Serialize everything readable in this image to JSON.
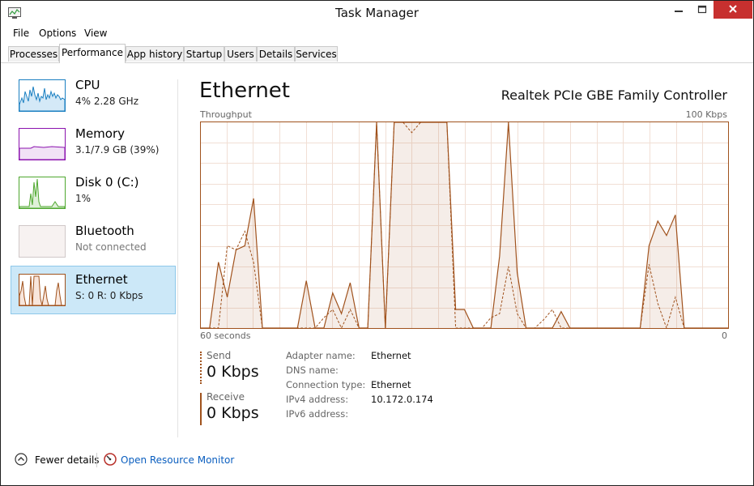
{
  "window": {
    "title": "Task Manager"
  },
  "menu": [
    "File",
    "Options",
    "View"
  ],
  "tabs": [
    "Processes",
    "Performance",
    "App history",
    "Startup",
    "Users",
    "Details",
    "Services"
  ],
  "active_tab": "Performance",
  "sidebar": {
    "items": [
      {
        "name": "CPU",
        "sub": "4% 2.28 GHz",
        "color": "#1a7fc1"
      },
      {
        "name": "Memory",
        "sub": "3.1/7.9 GB (39%)",
        "color": "#8b12ae"
      },
      {
        "name": "Disk 0 (C:)",
        "sub": "1%",
        "color": "#4ea72e"
      },
      {
        "name": "Bluetooth",
        "sub": "Not connected",
        "color": "#c0c0c0"
      },
      {
        "name": "Ethernet",
        "sub": "S: 0 R: 0 Kbps",
        "color": "#a0521d",
        "selected": true
      }
    ]
  },
  "main": {
    "title": "Ethernet",
    "adapter": "Realtek PCIe GBE Family Controller",
    "graph_label": "Throughput",
    "graph_max": "100 Kbps",
    "axis_left": "60 seconds",
    "axis_right": "0"
  },
  "send": {
    "label": "Send",
    "value": "0 Kbps"
  },
  "receive": {
    "label": "Receive",
    "value": "0 Kbps"
  },
  "properties": [
    {
      "key": "Adapter name:",
      "value": "Ethernet"
    },
    {
      "key": "DNS name:",
      "value": ""
    },
    {
      "key": "Connection type:",
      "value": "Ethernet"
    },
    {
      "key": "IPv4 address:",
      "value": "10.172.0.174"
    },
    {
      "key": "IPv6 address:",
      "value": ""
    }
  ],
  "footer": {
    "fewer_details": "Fewer details",
    "resource_monitor": "Open Resource Monitor"
  },
  "chart_data": {
    "type": "area",
    "ylim": [
      0,
      100
    ],
    "x": [
      0,
      1,
      2,
      3,
      4,
      5,
      6,
      7,
      8,
      9,
      10,
      11,
      12,
      13,
      14,
      15,
      16,
      17,
      18,
      19,
      20,
      21,
      22,
      23,
      24,
      25,
      26,
      27,
      28,
      29,
      30,
      31,
      32,
      33,
      34,
      35,
      36,
      37,
      38,
      39,
      40,
      41,
      42,
      43,
      44,
      45,
      46,
      47,
      48,
      49,
      50,
      51,
      52,
      53,
      54,
      55,
      56,
      57,
      58,
      59,
      60
    ],
    "series": [
      {
        "name": "Receive",
        "values": [
          0,
          0,
          32,
          15,
          38,
          40,
          63,
          0,
          0,
          0,
          0,
          0,
          23,
          0,
          0,
          17,
          7,
          22,
          0,
          0,
          100,
          0,
          100,
          100,
          100,
          100,
          100,
          100,
          100,
          9,
          9,
          0,
          0,
          0,
          35,
          100,
          27,
          0,
          0,
          0,
          0,
          8,
          0,
          0,
          0,
          0,
          0,
          0,
          0,
          0,
          0,
          40,
          52,
          45,
          55,
          0,
          0,
          0,
          0,
          0,
          0
        ]
      },
      {
        "name": "Send",
        "values": [
          0,
          0,
          0,
          40,
          38,
          47,
          32,
          0,
          0,
          0,
          0,
          0,
          0,
          0,
          5,
          9,
          0,
          9,
          0,
          0,
          100,
          0,
          100,
          100,
          95,
          100,
          100,
          100,
          100,
          0,
          0,
          0,
          0,
          5,
          7,
          30,
          7,
          0,
          0,
          4,
          9,
          0,
          0,
          0,
          0,
          0,
          0,
          0,
          0,
          0,
          0,
          31,
          12,
          0,
          15,
          0,
          0,
          0,
          0,
          0,
          0
        ]
      }
    ]
  }
}
